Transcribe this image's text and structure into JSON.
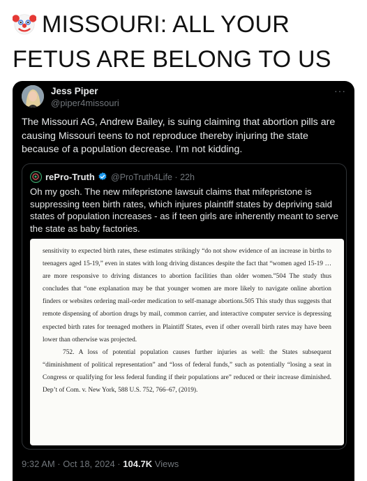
{
  "headline": {
    "emoji": "clown-face",
    "text": "MISSOURI: ALL YOUR FETUS ARE BELONG TO US"
  },
  "tweet": {
    "author_name": "Jess Piper",
    "author_handle": "@piper4missouri",
    "more_label": "···",
    "text": "The Missouri AG, Andrew Bailey, is suing claiming that abortion pills are causing Missouri teens to not reproduce thereby injuring the state because of a population decrease. I’m not kidding.",
    "quote": {
      "name": "rePro-Truth",
      "handle_time": "@ProTruth4Life · 22h",
      "text": "Oh my gosh. The new mifepristone lawsuit claims that mifepristone is suppressing teen birth rates, which injures plaintiff states by depriving said states of population increases - as if teen girls are inherently meant to serve the state as baby factories.",
      "document": {
        "para1": "sensitivity to expected birth rates, these estimates strikingly “do not show evidence of an increase in births to teenagers aged 15-19,” even in states with long driving distances despite the fact that “women aged 15-19 … are more responsive to driving distances to abortion facilities than older women.”504 The study thus concludes that “one explanation may be that younger women are more likely to navigate online abortion finders or websites ordering mail-order medication to self-manage abortions.505 This study thus suggests that remote dispensing of abortion drugs by mail, common carrier, and interactive computer service is depressing expected birth rates for teenaged mothers in Plaintiff States, even if other overall birth rates may have been lower than otherwise was projected.",
        "para2": "752.  A loss of potential population causes further injuries as well: the States subsequent “diminishment of political representation” and “loss of federal funds,” such as potentially “losing a seat in Congress or qualifying for less federal funding if their populations are” reduced or their increase diminished. Dep’t of Com. v. New York, 588 U.S. 752, 766–67, (2019)."
      }
    },
    "time": "9:32 AM · Oct 18, 2024 · ",
    "views_count": "104.7K",
    "views_label": " Views"
  }
}
